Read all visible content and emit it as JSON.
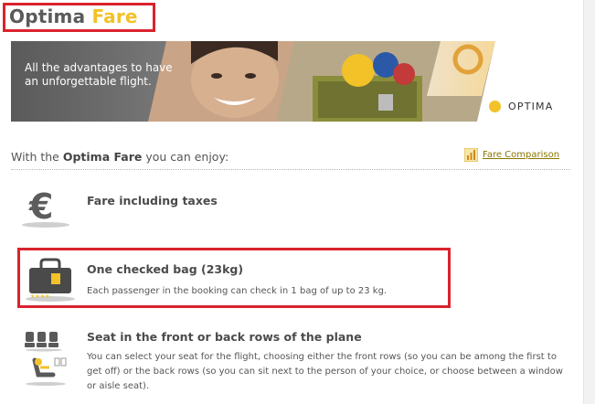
{
  "header": {
    "title_word1": "Optima",
    "title_word2": "Fare"
  },
  "banner": {
    "text": "All the advantages to have an unforgettable flight.",
    "brand": "OPTIMA"
  },
  "intro": {
    "prefix": "With the ",
    "fare_name": "Optima Fare",
    "suffix": " you can enjoy:",
    "comparison_link": "Fare Comparison"
  },
  "features": [
    {
      "title": "Fare including taxes",
      "icon": "euro-icon"
    },
    {
      "title": "One checked bag (23kg)",
      "description": "Each passenger in the booking can check in 1 bag of up to 23 kg.",
      "icon": "bag-icon"
    },
    {
      "title": "Seat in the front or back rows of the plane",
      "description": "You can select your seat for the flight, choosing either the front rows (so you can be among the first to get off) or the back rows (so you can sit next to the person of your choice, or choose between a window or aisle seat).",
      "icon": "seat-icon"
    }
  ],
  "colors": {
    "accent_yellow": "#f2c228",
    "highlight_red": "#d9232e",
    "title_gray": "#5a5a5a"
  }
}
